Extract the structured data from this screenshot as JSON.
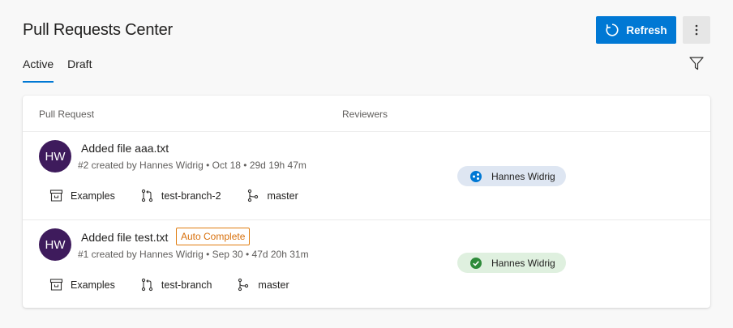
{
  "header": {
    "title": "Pull Requests Center",
    "refresh_label": "Refresh"
  },
  "tabs": [
    {
      "label": "Active",
      "active": true
    },
    {
      "label": "Draft",
      "active": false
    }
  ],
  "table": {
    "columns": [
      "Pull Request",
      "Reviewers"
    ]
  },
  "pull_requests": [
    {
      "avatar": "HW",
      "title": "Added file aaa.txt",
      "badge": "",
      "meta": "#2 created by Hannes Widrig • Oct 18 • 29d 19h 47m",
      "repo": "Examples",
      "source_branch": "test-branch-2",
      "target_branch": "master",
      "reviewer": {
        "name": "Hannes Widrig",
        "status": "waiting"
      }
    },
    {
      "avatar": "HW",
      "title": "Added file test.txt",
      "badge": "Auto Complete",
      "meta": "#1 created by Hannes Widrig • Sep 30 • 47d 20h 31m",
      "repo": "Examples",
      "source_branch": "test-branch",
      "target_branch": "master",
      "reviewer": {
        "name": "Hannes Widrig",
        "status": "approved"
      }
    }
  ],
  "colors": {
    "accent": "#0078d4",
    "avatar": "#3e1b5c",
    "badge_orange": "#e07d10",
    "approved_green": "#2e8b3a"
  }
}
